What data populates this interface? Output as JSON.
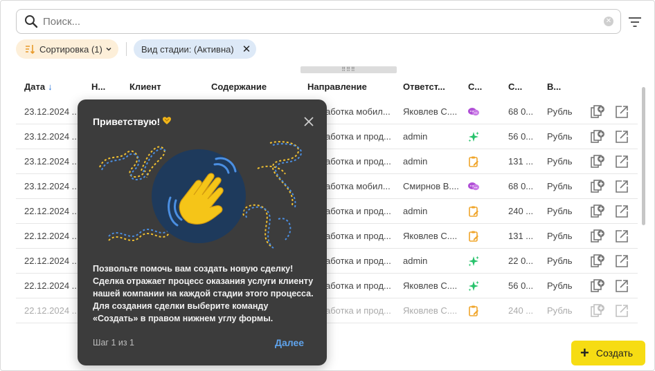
{
  "search": {
    "placeholder": "Поиск...",
    "value": ""
  },
  "chips": {
    "sort_label": "Сортировка (1)",
    "stage_label": "Вид стадии: (Активна)"
  },
  "columns": [
    {
      "label": "Дата",
      "sorted": "desc"
    },
    {
      "label": "Н..."
    },
    {
      "label": "Клиент"
    },
    {
      "label": "Содержание"
    },
    {
      "label": "Направление"
    },
    {
      "label": "Ответст..."
    },
    {
      "label": "С..."
    },
    {
      "label": "С..."
    },
    {
      "label": "В..."
    }
  ],
  "rows": [
    {
      "date": "23.12.2024 ...",
      "direction": "аботка мобил...",
      "owner": "Яковлев С....",
      "stage_icon": "chat-icon",
      "sum": "68 0...",
      "currency": "Рубль"
    },
    {
      "date": "23.12.2024 ...",
      "direction": "аботка и прод...",
      "owner": "admin",
      "stage_icon": "sparkle-icon",
      "sum": "56 0...",
      "currency": "Рубль"
    },
    {
      "date": "23.12.2024 ...",
      "direction": "аботка и прод...",
      "owner": "admin",
      "stage_icon": "clipboard-icon",
      "sum": "131 ...",
      "currency": "Рубль"
    },
    {
      "date": "23.12.2024 ...",
      "direction": "аботка мобил...",
      "owner": "Смирнов В....",
      "stage_icon": "chat-icon",
      "sum": "68 0...",
      "currency": "Рубль"
    },
    {
      "date": "22.12.2024 ...",
      "direction": "аботка и прод...",
      "owner": "admin",
      "stage_icon": "clipboard-icon",
      "sum": "240 ...",
      "currency": "Рубль"
    },
    {
      "date": "22.12.2024 ...",
      "direction": "аботка и прод...",
      "owner": "Яковлев С....",
      "stage_icon": "clipboard-icon",
      "sum": "131 ...",
      "currency": "Рубль"
    },
    {
      "date": "22.12.2024 ...",
      "direction": "аботка и прод...",
      "owner": "admin",
      "stage_icon": "sparkle-icon",
      "sum": "22 0...",
      "currency": "Рубль"
    },
    {
      "date": "22.12.2024 ...",
      "direction": "аботка и прод...",
      "owner": "Яковлев С....",
      "stage_icon": "sparkle-icon",
      "sum": "56 0...",
      "currency": "Рубль"
    },
    {
      "date": "22.12.2024 ...",
      "direction": "аботка и прод...",
      "owner": "Яковлев С....",
      "stage_icon": "clipboard-icon",
      "sum": "240 ...",
      "currency": "Рубль"
    }
  ],
  "tour": {
    "title": "Приветствую!",
    "body": "Позвольте помочь вам создать новую сделку! Сделка отражает процесс оказания услуги клиенту нашей компании на каждой стадии этого процесса. Для создания сделки выберите команду «Создать» в правом нижнем углу формы.",
    "step": "Шаг 1 из 1",
    "next_label": "Далее"
  },
  "create_button": {
    "label": "Создать"
  },
  "colors": {
    "accent_blue": "#1e6fd9",
    "create_yellow": "#f6dc13",
    "sort_chip_bg": "#fdefd9",
    "stage_chip_bg": "#dde9f7",
    "tour_bg": "#3c3c3c",
    "tour_link": "#5fa3ec"
  }
}
